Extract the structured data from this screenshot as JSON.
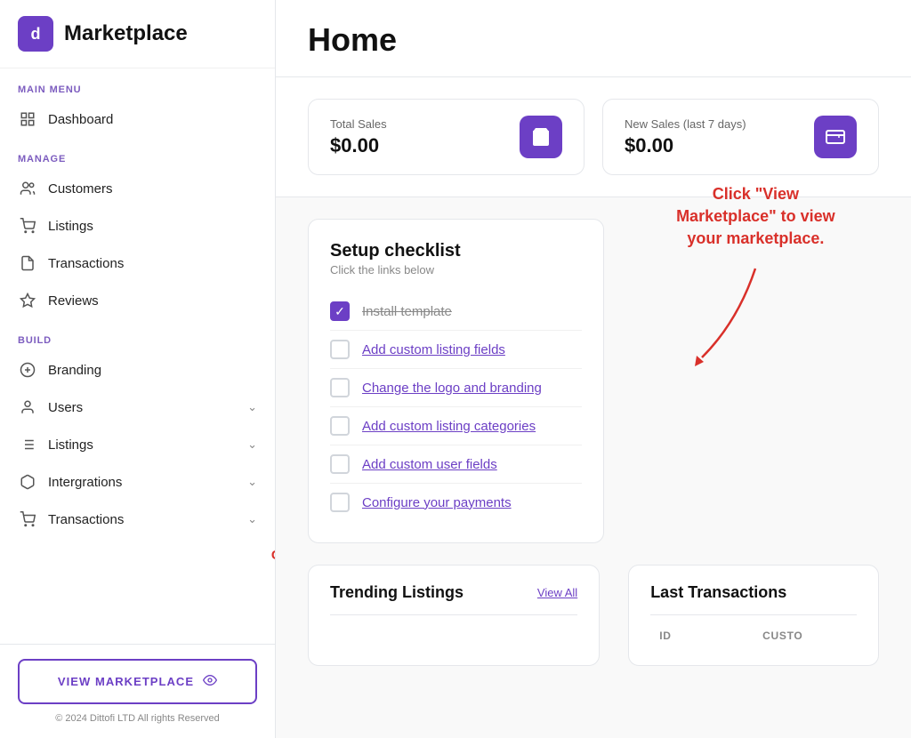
{
  "app": {
    "logo_letter": "d",
    "title": "Marketplace"
  },
  "sidebar": {
    "main_menu_label": "MAIN MENU",
    "manage_label": "MANAGE",
    "build_label": "BUILD",
    "items_main": [
      {
        "id": "dashboard",
        "label": "Dashboard",
        "icon": "grid"
      }
    ],
    "items_manage": [
      {
        "id": "customers",
        "label": "Customers",
        "icon": "users"
      },
      {
        "id": "listings",
        "label": "Listings",
        "icon": "shopping-cart"
      },
      {
        "id": "transactions",
        "label": "Transactions",
        "icon": "file"
      },
      {
        "id": "reviews",
        "label": "Reviews",
        "icon": "star"
      }
    ],
    "items_build": [
      {
        "id": "branding",
        "label": "Branding",
        "icon": "plus-circle",
        "hasChevron": false
      },
      {
        "id": "users",
        "label": "Users",
        "icon": "user",
        "hasChevron": true
      },
      {
        "id": "listings-build",
        "label": "Listings",
        "icon": "list",
        "hasChevron": true
      },
      {
        "id": "integrations",
        "label": "Intergrations",
        "icon": "cube",
        "hasChevron": true
      },
      {
        "id": "transactions-build",
        "label": "Transactions",
        "icon": "cart",
        "hasChevron": true
      }
    ],
    "view_marketplace_label": "VIEW MARKETPLACE",
    "copyright": "© 2024 Dittofi LTD All rights Reserved"
  },
  "main": {
    "title": "Home",
    "stats": [
      {
        "label": "Total Sales",
        "value": "$0.00",
        "icon": "cart"
      },
      {
        "label": "New Sales (last 7 days)",
        "value": "$0.00",
        "icon": "wallet"
      }
    ],
    "checklist": {
      "title": "Setup checklist",
      "subtitle": "Click the links below",
      "items": [
        {
          "label": "Install template",
          "checked": true,
          "strikethrough": true,
          "link": false
        },
        {
          "label": "Add custom listing fields",
          "checked": false,
          "strikethrough": false,
          "link": true
        },
        {
          "label": "Change the logo and branding",
          "checked": false,
          "strikethrough": false,
          "link": true
        },
        {
          "label": "Add custom listing categories",
          "checked": false,
          "strikethrough": false,
          "link": true
        },
        {
          "label": "Add custom user fields",
          "checked": false,
          "strikethrough": false,
          "link": true
        },
        {
          "label": "Configure your payments",
          "checked": false,
          "strikethrough": false,
          "link": true
        }
      ]
    },
    "annotation": {
      "text": "Click “View Marketplace” to view your marketplace.",
      "color": "#d9302a"
    },
    "trending": {
      "title": "Trending Listings",
      "view_all": "View All"
    },
    "transactions": {
      "title": "Last Transactions",
      "columns": [
        "ID",
        "CUSTO"
      ]
    }
  }
}
